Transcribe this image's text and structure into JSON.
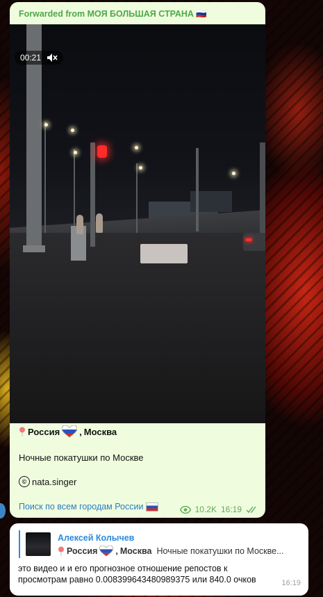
{
  "forward": {
    "label": "Forwarded from МОЯ БОЛЬШАЯ СТРАНА",
    "flag": "🇷🇺"
  },
  "video": {
    "duration": "00:21",
    "mute_icon": "muted-speaker-icon"
  },
  "post": {
    "location_country": "Россия",
    "location_sep": ",",
    "location_city": "Москва",
    "description": "Ночные покатушки по Москве",
    "credit_symbol": "©",
    "credit": "nata.singer",
    "search_link": "Поиск по всем городам России",
    "views": "10.2K",
    "time": "16:19"
  },
  "reply_message": {
    "reply_author": "Алексей Колычев",
    "reply_country": "Россия",
    "reply_sep": ",",
    "reply_city": "Москва",
    "reply_snippet": "Ночные покатушки по Москве...",
    "text": "это видео и и его прогнозное отношение репостов к просмотрам равно 0.008399643480989375 или 840.0 очков",
    "time": "16:19"
  },
  "colors": {
    "bubble": "#effdde",
    "accent_green": "#4ea84a",
    "link_blue": "#2b7cc6",
    "reply_blue": "#2b8adf"
  }
}
